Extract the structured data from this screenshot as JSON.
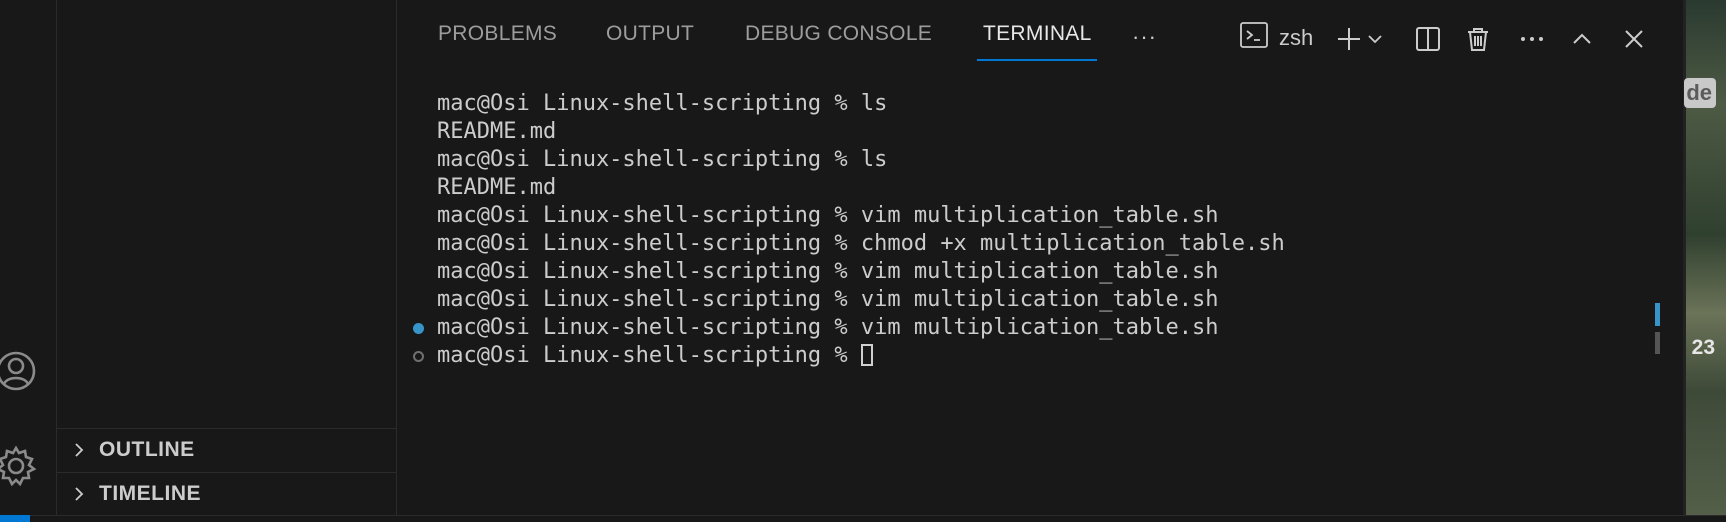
{
  "activity_bar": {
    "icons": [
      "accounts-icon",
      "gear-icon"
    ]
  },
  "side_bar": {
    "sections": [
      {
        "label": "OUTLINE",
        "icon": "chevron-right-icon"
      },
      {
        "label": "TIMELINE",
        "icon": "chevron-right-icon"
      }
    ]
  },
  "panel": {
    "tabs": [
      {
        "label": "PROBLEMS"
      },
      {
        "label": "OUTPUT"
      },
      {
        "label": "DEBUG CONSOLE"
      },
      {
        "label": "TERMINAL"
      }
    ],
    "active_tab": "TERMINAL",
    "more_label": "···",
    "terminal_name": "zsh",
    "action_icons": [
      "terminal-icon",
      "add-icon",
      "chevron-down-icon",
      "split-editor-icon",
      "trash-icon",
      "more-icon",
      "chevron-up-icon",
      "close-icon"
    ]
  },
  "terminal": {
    "lines": [
      "mac@Osi Linux-shell-scripting % ls",
      "README.md",
      "mac@Osi Linux-shell-scripting % ls",
      "README.md",
      "mac@Osi Linux-shell-scripting % vim multiplication_table.sh",
      "mac@Osi Linux-shell-scripting % chmod +x multiplication_table.sh",
      "mac@Osi Linux-shell-scripting % vim multiplication_table.sh",
      "mac@Osi Linux-shell-scripting % vim multiplication_table.sh",
      "mac@Osi Linux-shell-scripting % vim multiplication_table.sh",
      "mac@Osi Linux-shell-scripting % "
    ]
  },
  "background": {
    "chip_text": "de",
    "number_text": "23"
  },
  "colors": {
    "accent": "#0078d4",
    "success_decoration": "#3794c8",
    "background": "#181818",
    "foreground": "#cccccc"
  }
}
